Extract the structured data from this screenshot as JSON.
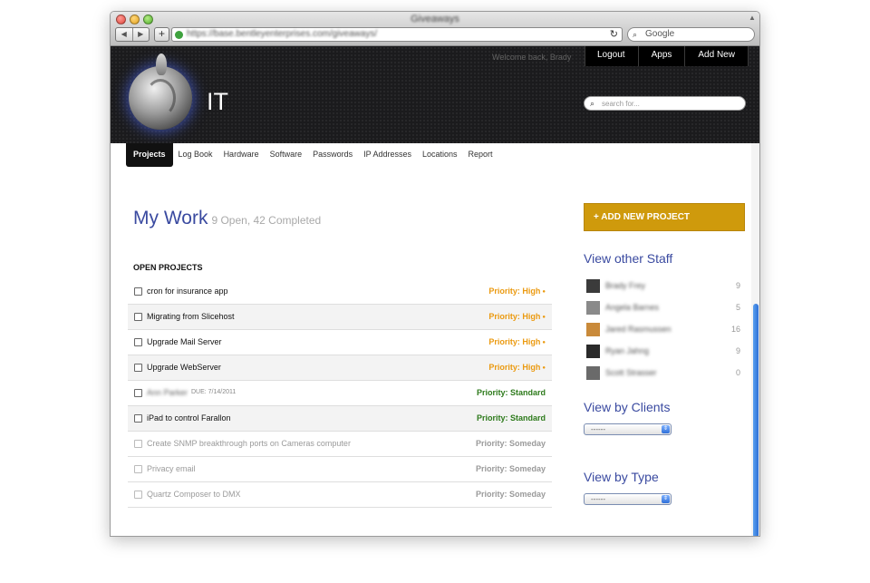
{
  "browser": {
    "window_title": "Giveaways",
    "url": "https://base.bentleyenterprises.com/giveaways/",
    "search_placeholder": "Google",
    "back": "◀",
    "forward": "▶",
    "new_tab": "+",
    "reload": "↻"
  },
  "header": {
    "brand": "IT",
    "welcome": "Welcome back, Brady",
    "menu": [
      "Logout",
      "Apps",
      "Add New"
    ],
    "search_placeholder": "search for..."
  },
  "tabs": [
    "Projects",
    "Log Book",
    "Hardware",
    "Software",
    "Passwords",
    "IP Addresses",
    "Locations",
    "Report"
  ],
  "main": {
    "title": "My Work",
    "subtitle": "9 Open, 42 Completed",
    "section_label": "OPEN PROJECTS",
    "projects": [
      {
        "name": "cron for insurance app",
        "due": "",
        "priority": "Priority: High"
      },
      {
        "name": "Migrating from Slicehost",
        "due": "",
        "priority": "Priority: High"
      },
      {
        "name": "Upgrade Mail Server",
        "due": "",
        "priority": "Priority: High"
      },
      {
        "name": "Upgrade WebServer",
        "due": "",
        "priority": "Priority: High"
      },
      {
        "name": "Ann Parker",
        "due": "DUE: 7/14/2011",
        "priority": "Priority: Standard"
      },
      {
        "name": "iPad to control Farallon",
        "due": "",
        "priority": "Priority: Standard"
      },
      {
        "name": "Create SNMP breakthrough ports on Cameras computer",
        "due": "",
        "priority": "Priority: Someday"
      },
      {
        "name": "Privacy email",
        "due": "",
        "priority": "Priority: Someday"
      },
      {
        "name": "Quartz Composer to DMX",
        "due": "",
        "priority": "Priority: Someday"
      }
    ]
  },
  "sidebar": {
    "add_button": "+ ADD NEW PROJECT",
    "staff_title": "View other Staff",
    "staff": [
      {
        "name": "Brady Frey",
        "count": "9"
      },
      {
        "name": "Angela Barnes",
        "count": "5"
      },
      {
        "name": "Jared Rasmussen",
        "count": "16"
      },
      {
        "name": "Ryan Jahng",
        "count": "9"
      },
      {
        "name": "Scott Strasser",
        "count": "0"
      }
    ],
    "clients_title": "View by Clients",
    "clients_select": "------",
    "type_title": "View by Type",
    "type_select": "------"
  },
  "colors": {
    "accent_blue": "#3a4aa0",
    "button_gold": "#cf9a0c",
    "priority_high": "#eb9a10",
    "priority_standard": "#2d7a1b",
    "priority_someday": "#9a9a9a"
  }
}
